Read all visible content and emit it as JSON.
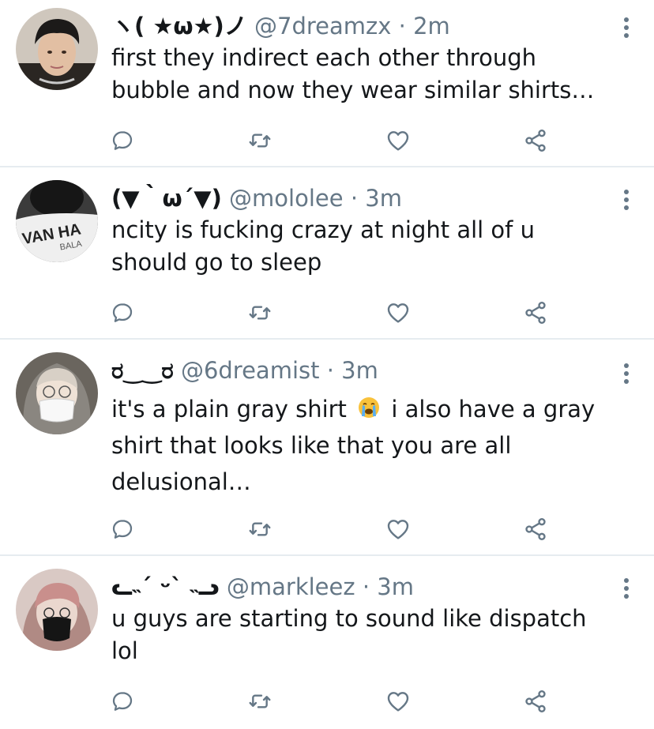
{
  "tweets": [
    {
      "display_name": "ヽ( ★ω★)ノ",
      "handle": "@7dreamzx",
      "separator": "·",
      "time": "2m",
      "text": "first they indirect each other through bubble and now they wear similar shirts…"
    },
    {
      "display_name": "(▼｀ω´▼)",
      "handle": "@mololee",
      "separator": "·",
      "time": "3m",
      "text": "ncity is fucking crazy at night all of u should go to sleep",
      "avatar_shirt_text_1": "VAN HA",
      "avatar_shirt_text_2": "BALA"
    },
    {
      "display_name": "ರ‿‿ರ",
      "handle": "@6dreamist",
      "separator": "·",
      "time": "3m",
      "text_before_emoji": "it's a plain gray shirt",
      "emoji": "loudly-crying-face",
      "text_after_emoji": "i also have a gray shirt that looks like that you are all delusional…"
    },
    {
      "display_name": "ᓚ˵´ ᵕ` ˵ᓗ",
      "handle": "@markleez",
      "separator": "·",
      "time": "3m",
      "text": "u guys are starting to sound like dispatch lol"
    }
  ],
  "icons": {
    "reply": "reply-icon",
    "retweet": "retweet-icon",
    "like": "heart-icon",
    "share": "share-icon",
    "menu": "more-vertical-icon"
  },
  "colors": {
    "icon": "#657786",
    "divider": "#e6ecf0",
    "text": "#14171a"
  }
}
